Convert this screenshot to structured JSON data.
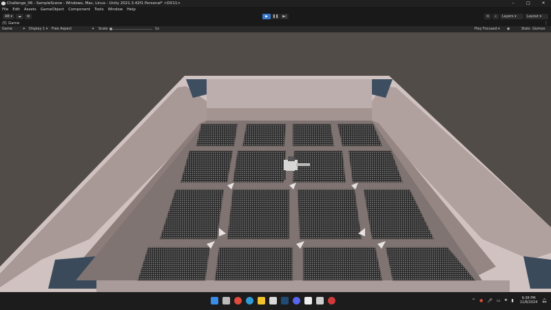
{
  "window": {
    "title": "Challenge_06 - SampleScene - Windows, Mac, Linux - Unity 2021.3.42f1 Personal* <DX11>",
    "minimize_icon": "minimize-icon",
    "maximize_icon": "maximize-icon",
    "close_icon": "close-icon"
  },
  "menu": [
    "File",
    "Edit",
    "Assets",
    "GameObject",
    "Component",
    "Tools",
    "Window",
    "Help"
  ],
  "toolbar": {
    "account_label": "AB",
    "layers_label": "Layers",
    "layout_label": "Layout"
  },
  "tab": {
    "label": "Game"
  },
  "gamebar": {
    "mode": "Game",
    "display": "Display 1",
    "aspect": "Free Aspect",
    "scale_label": "Scale",
    "scale_value": "1x",
    "play_focused": "Play Focused",
    "stats": "Stats",
    "gizmos": "Gizmos"
  },
  "taskbar": {
    "time": "9:38 PM",
    "date": "11/8/2024"
  },
  "colors": {
    "viewport_bg": "#504a47",
    "wall": "#b9aaa8",
    "floor": "#8a7f7c",
    "grate": "#2a2a2a",
    "play_active": "#3a78c8"
  }
}
